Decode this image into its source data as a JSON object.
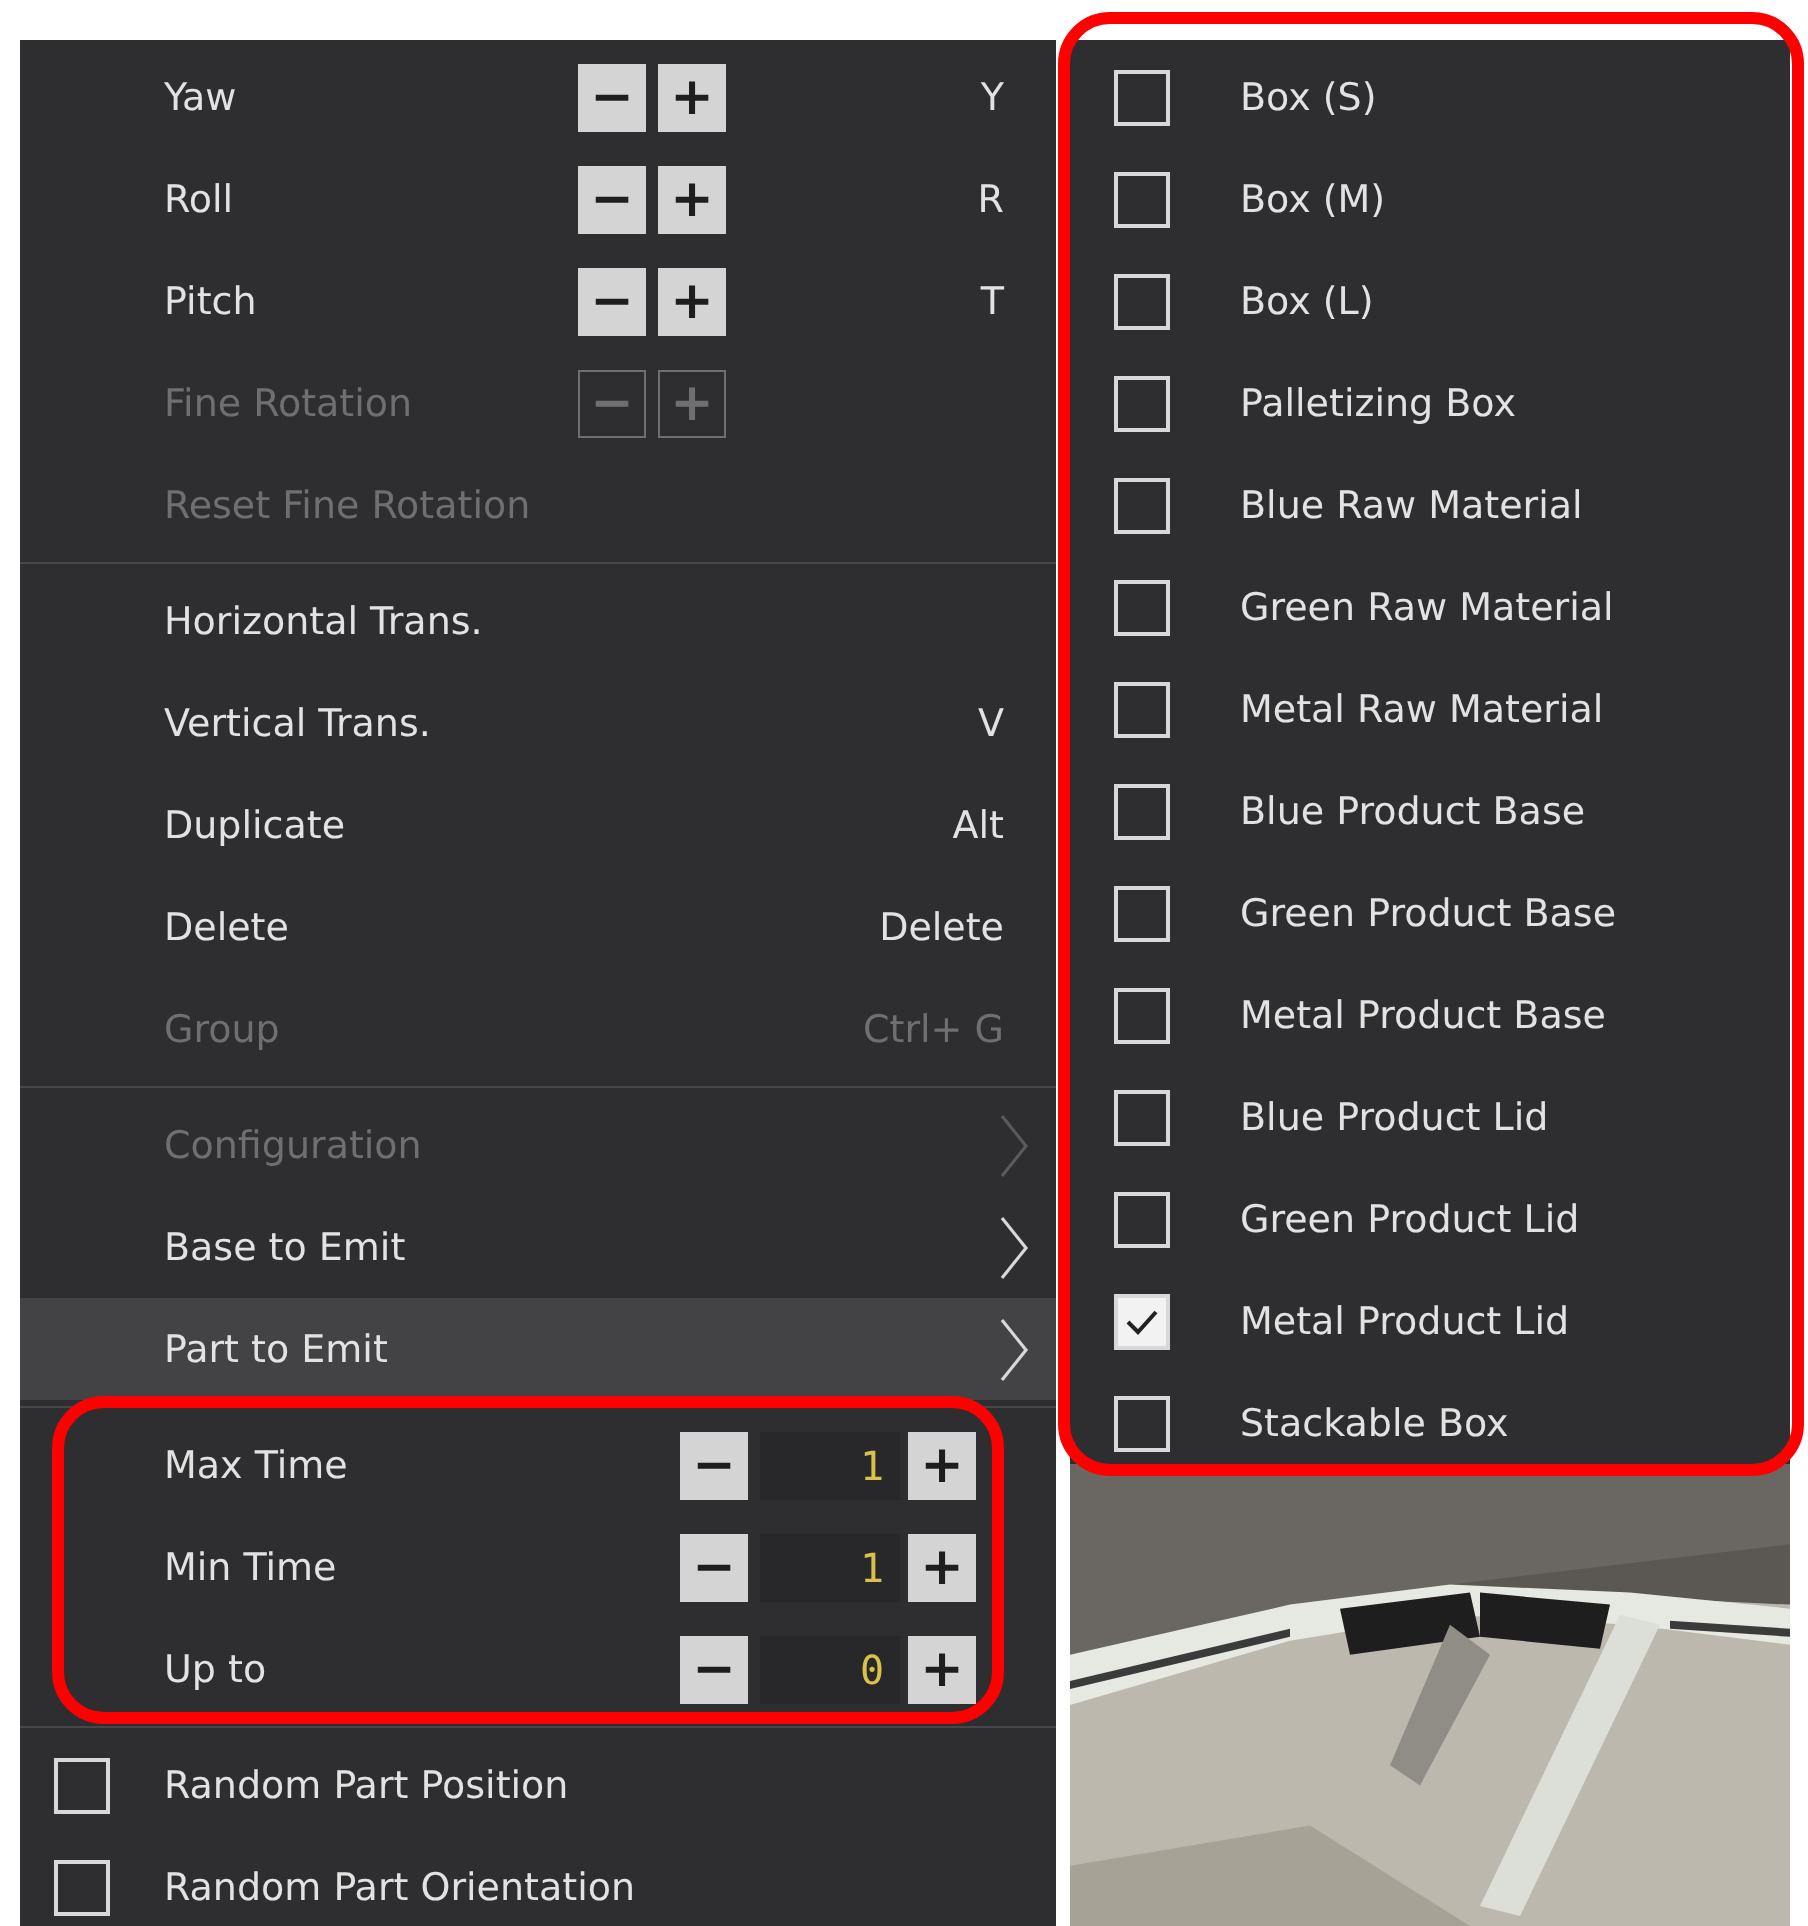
{
  "menu": {
    "sections": [
      {
        "items": [
          {
            "kind": "rotate",
            "label": "Yaw",
            "decrement": "−",
            "increment": "+",
            "shortcut": "Y",
            "disabled": false,
            "highlighted": false
          },
          {
            "kind": "rotate",
            "label": "Roll",
            "decrement": "−",
            "increment": "+",
            "shortcut": "R",
            "disabled": false,
            "highlighted": false
          },
          {
            "kind": "rotate",
            "label": "Pitch",
            "decrement": "−",
            "increment": "+",
            "shortcut": "T",
            "disabled": false,
            "highlighted": false
          },
          {
            "kind": "rotate",
            "label": "Fine Rotation",
            "decrement": "−",
            "increment": "+",
            "disabled": true,
            "highlighted": false
          },
          {
            "kind": "action",
            "label": "Reset Fine Rotation",
            "disabled": true,
            "highlighted": false
          }
        ]
      },
      {
        "items": [
          {
            "kind": "action",
            "label": "Horizontal Trans.",
            "disabled": false,
            "highlighted": false
          },
          {
            "kind": "action",
            "label": "Vertical Trans.",
            "shortcut": "V",
            "disabled": false,
            "highlighted": false
          },
          {
            "kind": "action",
            "label": "Duplicate",
            "shortcut": "Alt",
            "disabled": false,
            "highlighted": false
          },
          {
            "kind": "action",
            "label": "Delete",
            "shortcut": "Delete",
            "disabled": false,
            "highlighted": false
          },
          {
            "kind": "action",
            "label": "Group",
            "shortcut": "Ctrl+ G",
            "disabled": true,
            "highlighted": false
          }
        ]
      },
      {
        "items": [
          {
            "kind": "submenu",
            "label": "Configuration",
            "disabled": true,
            "highlighted": false
          },
          {
            "kind": "submenu",
            "label": "Base to Emit",
            "disabled": false,
            "highlighted": false
          },
          {
            "kind": "submenu",
            "label": "Part to Emit",
            "disabled": false,
            "highlighted": true
          }
        ]
      },
      {
        "items": [
          {
            "kind": "number",
            "label": "Max Time",
            "decrement": "−",
            "increment": "+",
            "value": "1",
            "disabled": false,
            "highlighted": false
          },
          {
            "kind": "number",
            "label": "Min Time",
            "decrement": "−",
            "increment": "+",
            "value": "1",
            "disabled": false,
            "highlighted": false
          },
          {
            "kind": "number",
            "label": "Up to",
            "decrement": "−",
            "increment": "+",
            "value": "0",
            "disabled": false,
            "highlighted": false
          }
        ]
      },
      {
        "items": [
          {
            "kind": "checkbox",
            "label": "Random Part Position",
            "checked": false,
            "disabled": false,
            "highlighted": false
          },
          {
            "kind": "checkbox",
            "label": "Random Part Orientation",
            "checked": false,
            "disabled": false,
            "highlighted": false
          }
        ]
      }
    ]
  },
  "submenu": {
    "items": [
      {
        "label": "Box (S)",
        "checked": false
      },
      {
        "label": "Box (M)",
        "checked": false
      },
      {
        "label": "Box (L)",
        "checked": false
      },
      {
        "label": "Palletizing Box",
        "checked": false
      },
      {
        "label": "Blue Raw Material",
        "checked": false
      },
      {
        "label": "Green Raw Material",
        "checked": false
      },
      {
        "label": "Metal Raw Material",
        "checked": false
      },
      {
        "label": "Blue Product Base",
        "checked": false
      },
      {
        "label": "Green Product Base",
        "checked": false
      },
      {
        "label": "Metal Product Base",
        "checked": false
      },
      {
        "label": "Blue Product Lid",
        "checked": false
      },
      {
        "label": "Green Product Lid",
        "checked": false
      },
      {
        "label": "Metal Product Lid",
        "checked": true
      },
      {
        "label": "Stackable Box",
        "checked": false
      }
    ]
  }
}
